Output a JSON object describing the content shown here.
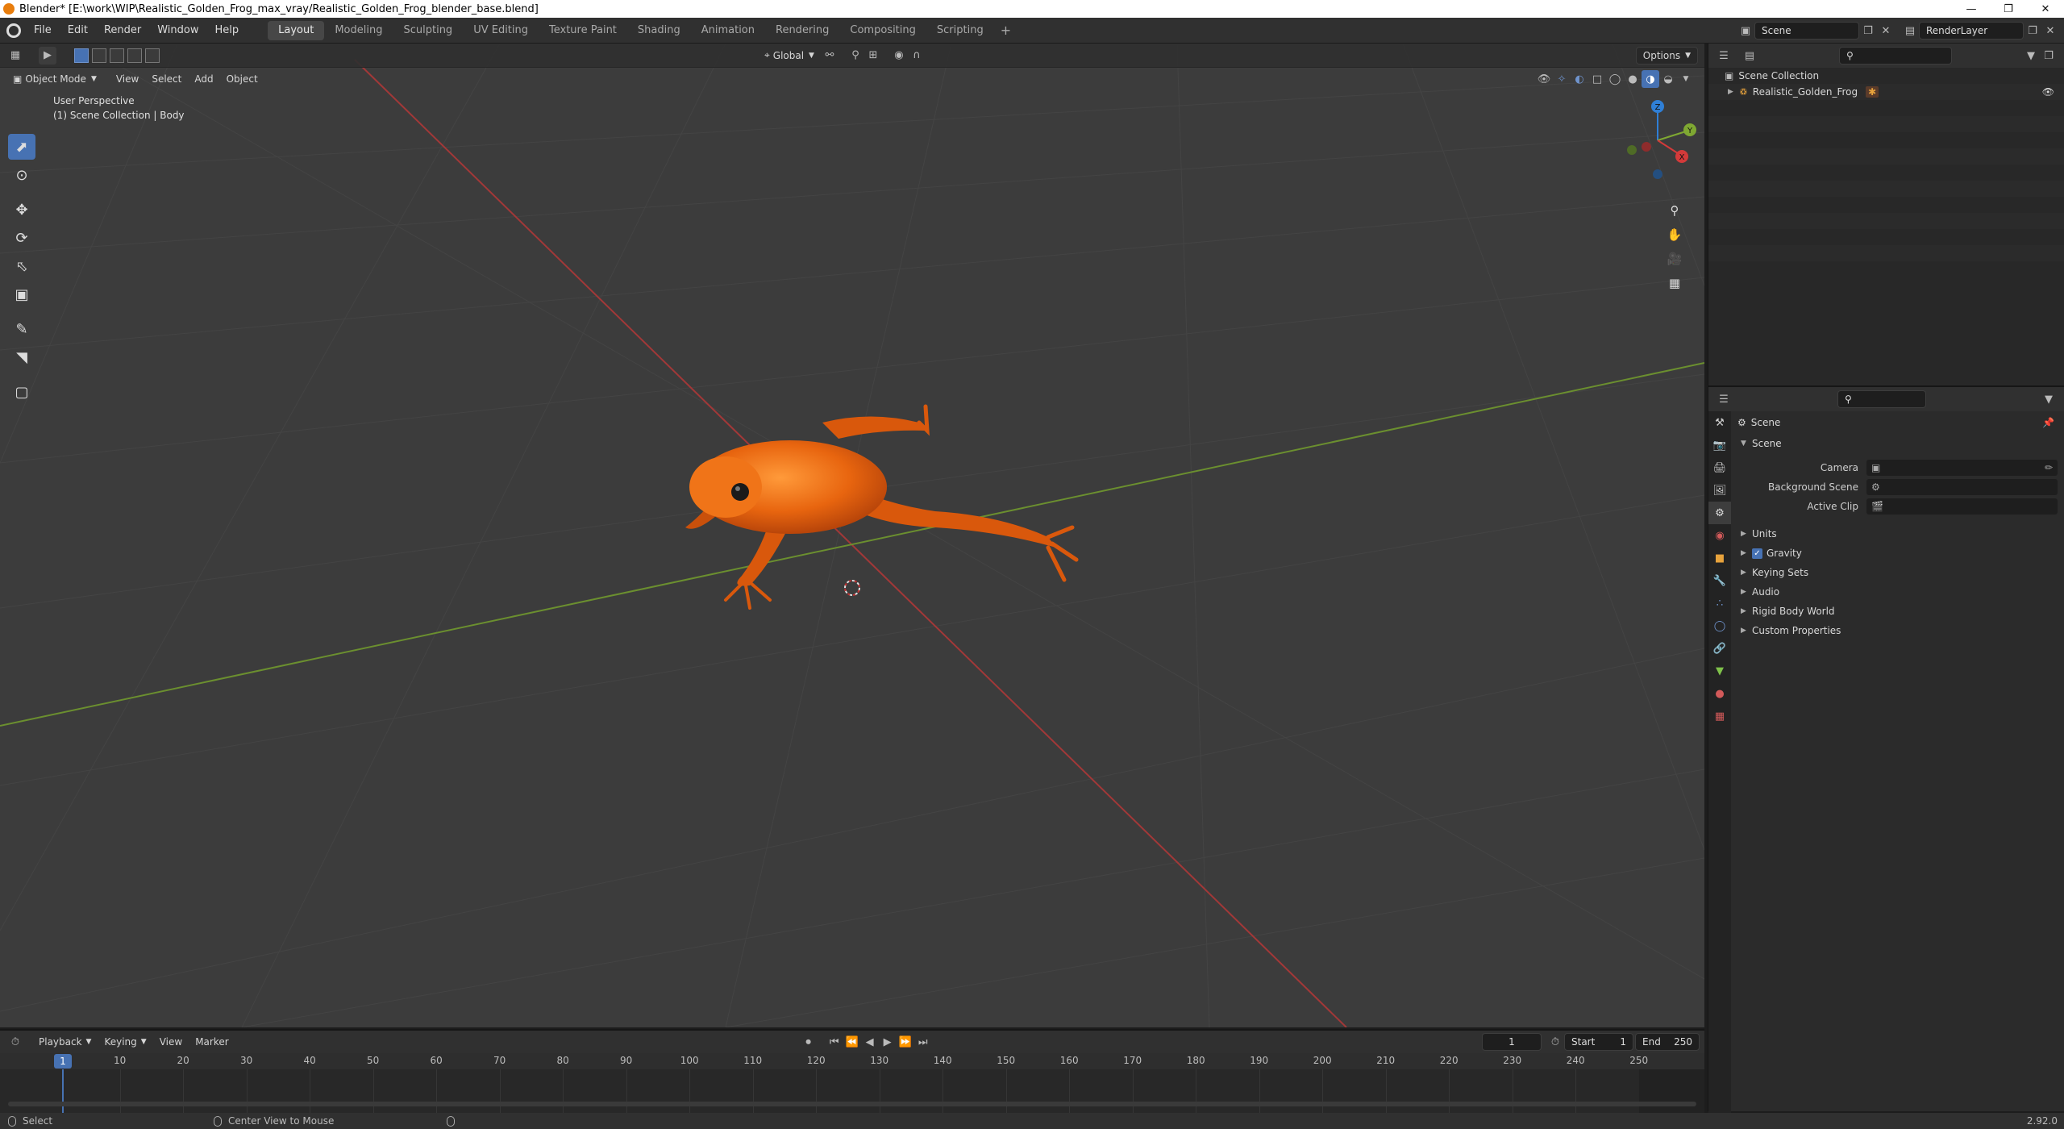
{
  "window": {
    "title": "Blender* [E:\\work\\WIP\\Realistic_Golden_Frog_max_vray/Realistic_Golden_Frog_blender_base.blend]"
  },
  "menu": [
    "File",
    "Edit",
    "Render",
    "Window",
    "Help"
  ],
  "workspaces": {
    "active": "Layout",
    "tabs": [
      "Layout",
      "Modeling",
      "Sculpting",
      "UV Editing",
      "Texture Paint",
      "Shading",
      "Animation",
      "Rendering",
      "Compositing",
      "Scripting"
    ]
  },
  "top_right": {
    "scene": "Scene",
    "view_layer": "RenderLayer"
  },
  "viewport": {
    "mode": "Object Mode",
    "menus": [
      "View",
      "Select",
      "Add",
      "Object"
    ],
    "orientation": "Global",
    "options": "Options",
    "info_line1": "User Perspective",
    "info_line2": "(1) Scene Collection | Body"
  },
  "gizmo": {
    "x": "X",
    "y": "Y",
    "z": "Z"
  },
  "outliner": {
    "rows": [
      {
        "label": "Scene Collection",
        "level": 0
      },
      {
        "label": "Realistic_Golden_Frog",
        "level": 1
      }
    ]
  },
  "properties": {
    "context": "Scene",
    "section": "Scene",
    "fields": [
      {
        "label": "Camera"
      },
      {
        "label": "Background Scene"
      },
      {
        "label": "Active Clip"
      }
    ],
    "panels": [
      {
        "label": "Units",
        "checkbox": false
      },
      {
        "label": "Gravity",
        "checkbox": true
      },
      {
        "label": "Keying Sets",
        "checkbox": false
      },
      {
        "label": "Audio",
        "checkbox": false
      },
      {
        "label": "Rigid Body World",
        "checkbox": false
      },
      {
        "label": "Custom Properties",
        "checkbox": false
      }
    ]
  },
  "timeline": {
    "menus": [
      "Playback",
      "Keying",
      "View",
      "Marker"
    ],
    "current_frame": "1",
    "start_label": "Start",
    "start": "1",
    "end_label": "End",
    "end": "250",
    "ticks": [
      "10",
      "20",
      "30",
      "40",
      "50",
      "60",
      "70",
      "80",
      "90",
      "100",
      "110",
      "120",
      "130",
      "140",
      "150",
      "160",
      "170",
      "180",
      "190",
      "200",
      "210",
      "220",
      "230",
      "240",
      "250"
    ]
  },
  "statusbar": {
    "left": "Select",
    "middle": "Center View to Mouse",
    "version": "2.92.0"
  },
  "colors": {
    "accent": "#4772b3",
    "x_axis": "#a23838",
    "y_axis": "#6b8f2f",
    "frog": "#e8650f"
  }
}
